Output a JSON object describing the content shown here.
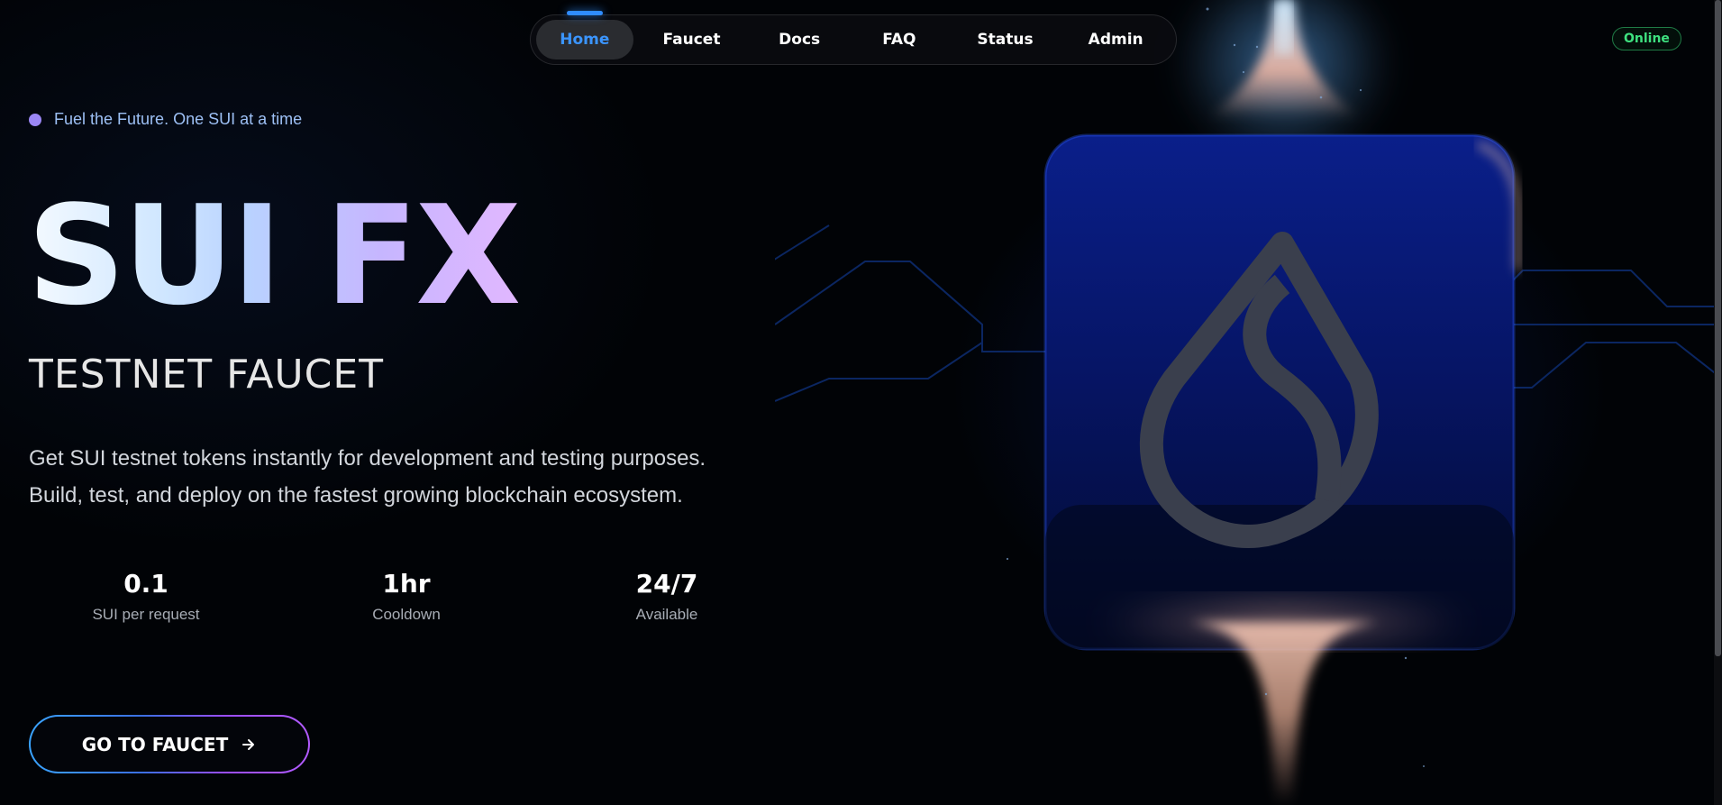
{
  "nav": {
    "items": [
      {
        "label": "Home",
        "active": true
      },
      {
        "label": "Faucet",
        "active": false
      },
      {
        "label": "Docs",
        "active": false
      },
      {
        "label": "FAQ",
        "active": false
      },
      {
        "label": "Status",
        "active": false
      },
      {
        "label": "Admin",
        "active": false
      }
    ]
  },
  "status_badge": {
    "label": "Online",
    "color": "#3ee07f"
  },
  "hero": {
    "tagline": "Fuel the Future. One SUI at a time",
    "title": "SUI FX",
    "subtitle": "TESTNET FAUCET",
    "description_lines": [
      "Get SUI testnet tokens instantly for development and testing purposes.",
      "Build, test, and deploy on the fastest growing blockchain ecosystem."
    ],
    "stats": [
      {
        "value": "0.1",
        "label": "SUI per request"
      },
      {
        "value": "1hr",
        "label": "Cooldown"
      },
      {
        "value": "24/7",
        "label": "Available"
      }
    ],
    "cta_label": "GO TO FAUCET",
    "cta_icon": "arrow-right-icon",
    "art_icon": "sui-droplet-logo-icon"
  },
  "colors": {
    "accent_blue": "#3b95ff",
    "accent_purple": "#b25bff",
    "background": "#010306",
    "online_green": "#3ee07f"
  }
}
